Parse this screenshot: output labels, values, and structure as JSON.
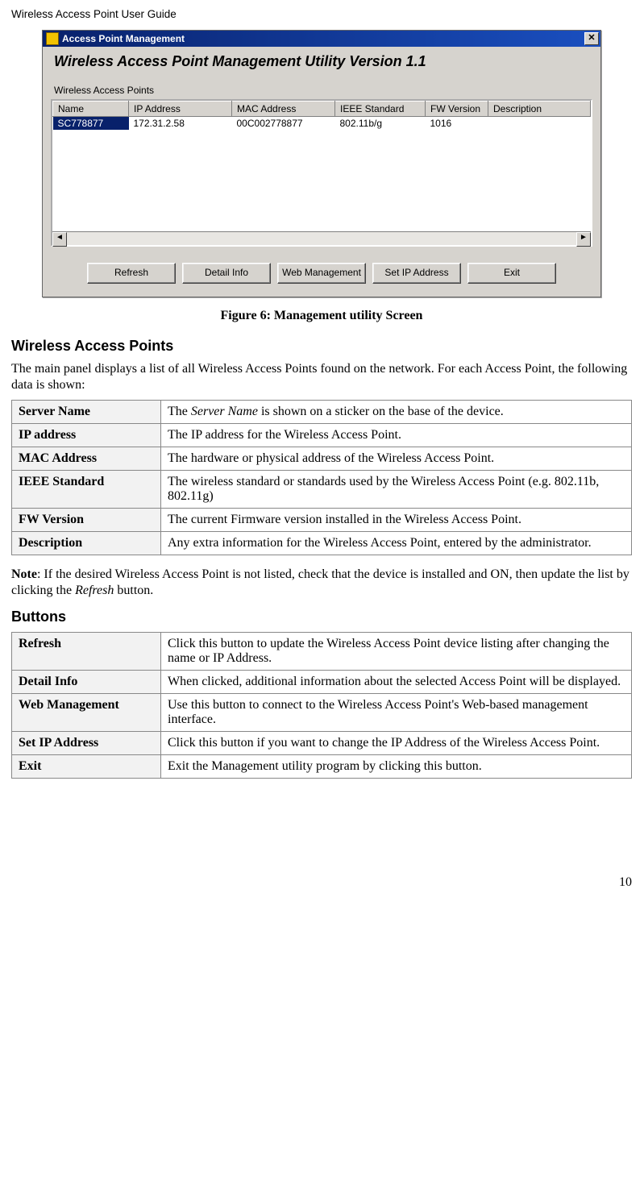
{
  "header": {
    "title": "Wireless Access Point User Guide"
  },
  "window": {
    "title": "Access Point Management",
    "subtitle": "Wireless Access Point Management Utility Version 1.1",
    "section_label": "Wireless Access Points",
    "columns": {
      "name": "Name",
      "ip": "IP Address",
      "mac": "MAC  Address",
      "ieee": "IEEE Standard",
      "fw": "FW Version",
      "desc": "Description"
    },
    "row": {
      "name": "SC778877",
      "ip": "172.31.2.58",
      "mac": "00C002778877",
      "ieee": "802.11b/g",
      "fw": "1016",
      "desc": ""
    },
    "buttons": {
      "refresh": "Refresh",
      "detail": "Detail Info",
      "web": "Web Management",
      "setip": "Set IP Address",
      "exit": "Exit"
    },
    "close_glyph": "✕"
  },
  "caption": "Figure 6: Management utility Screen",
  "sections": {
    "wap_heading": "Wireless Access Points",
    "wap_intro": "The main panel displays a list of all Wireless Access Points found on the network. For each Access Point, the following data is shown:",
    "buttons_heading": "Buttons"
  },
  "params_table": {
    "rows": {
      "server_name": {
        "label": "Server Name",
        "desc_pre": "The ",
        "desc_em": "Server Name",
        "desc_post": " is shown on a sticker on the base of the device."
      },
      "ip_address": {
        "label": "IP address",
        "desc": "The IP address for the Wireless Access Point."
      },
      "mac_address": {
        "label": "MAC Address",
        "desc": "The hardware or physical address of the Wireless Access Point."
      },
      "ieee": {
        "label": "IEEE Standard",
        "desc": "The wireless standard or standards used by the Wireless Access Point (e.g. 802.11b, 802.11g)"
      },
      "fw": {
        "label": "FW Version",
        "desc": "The current Firmware version installed in the Wireless Access Point."
      },
      "desc": {
        "label": "Description",
        "desc": "Any extra information for the Wireless Access Point, entered by the administrator."
      }
    }
  },
  "note": {
    "label": "Note",
    "text_pre": ":  If the desired Wireless Access Point is not listed, check that the device is installed and ON, then update the list by clicking the ",
    "em": "Refresh",
    "text_post": " button."
  },
  "buttons_table": {
    "rows": {
      "refresh": {
        "label": "Refresh",
        "desc": "Click this button to update the Wireless Access Point device listing after changing the name or IP Address."
      },
      "detail": {
        "label": "Detail Info",
        "desc": "When clicked, additional information about the selected Access Point will be displayed."
      },
      "web": {
        "label": "Web Management",
        "desc": "Use this button to connect to the Wireless Access Point's Web-based management interface."
      },
      "setip": {
        "label": "Set IP Address",
        "desc": "Click this button if you want to change the IP Address of the Wireless Access Point."
      },
      "exit": {
        "label": "Exit",
        "desc": "Exit the Management utility program by clicking this button."
      }
    }
  },
  "page_number": "10"
}
